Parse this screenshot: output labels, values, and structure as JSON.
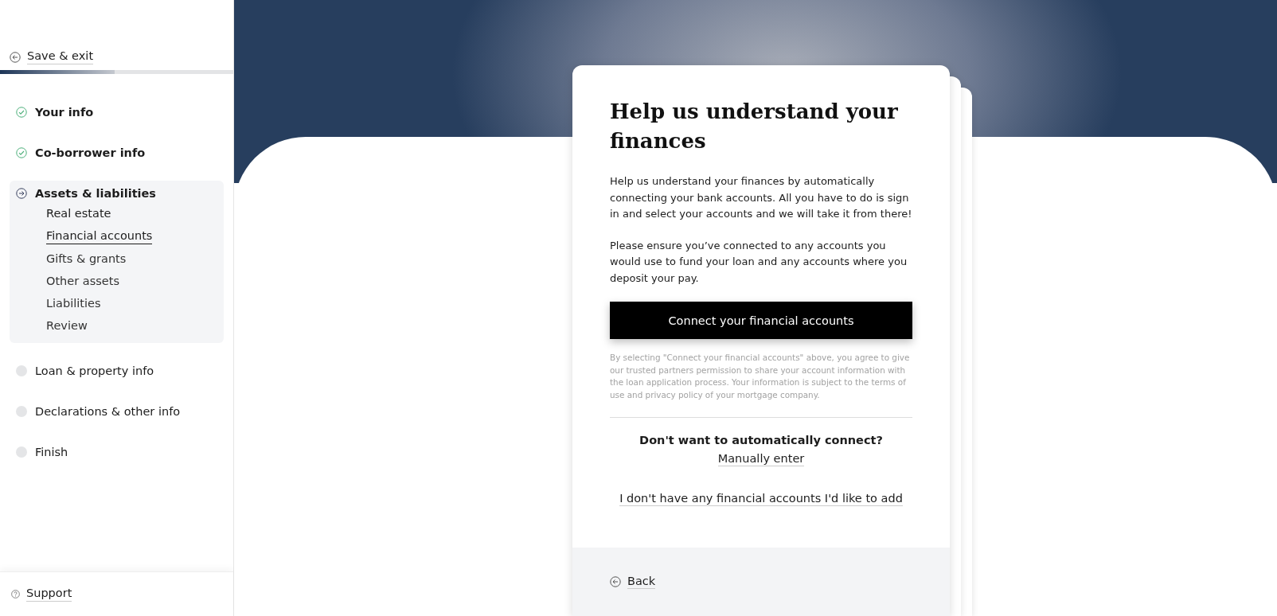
{
  "sidebar": {
    "save_exit": "Save & exit",
    "progress": {
      "level": 0.49
    },
    "steps": [
      {
        "label": "Your info",
        "kind": "done",
        "expanded": false
      },
      {
        "label": "Co-borrower info",
        "kind": "done",
        "expanded": false
      },
      {
        "label": "Assets & liabilities",
        "kind": "current",
        "expanded": true,
        "children": [
          {
            "label": "Real estate",
            "selected": false,
            "kind": "done"
          },
          {
            "label": "Financial accounts",
            "selected": true,
            "kind": "current"
          },
          {
            "label": "Gifts & grants",
            "selected": false,
            "kind": "todo"
          },
          {
            "label": "Other assets",
            "selected": false,
            "kind": "todo"
          },
          {
            "label": "Liabilities",
            "selected": false,
            "kind": "todo"
          },
          {
            "label": "Review",
            "selected": false,
            "kind": "todo"
          }
        ]
      },
      {
        "label": "Loan & property info",
        "kind": "todo",
        "expanded": false
      },
      {
        "label": "Declarations & other info",
        "kind": "todo",
        "expanded": false
      },
      {
        "label": "Finish",
        "kind": "todo",
        "expanded": false
      }
    ],
    "support": "Support"
  },
  "card": {
    "title": "Help us understand your finances",
    "paragraphs": [
      "Help us understand your finances by automatically connecting your bank accounts. All you have to do is sign in and select your accounts and we will take it from there!",
      "Please ensure you’ve connected to any accounts you would use to fund your loan and any accounts where you deposit your pay."
    ],
    "connect_button": "Connect your financial accounts",
    "disclaimer": "By selecting \"Connect your financial accounts\" above, you agree to give our trusted partners permission to share your account information with the loan application process. Your information is subject to the terms of use and privacy policy of your mortgage company.",
    "manual_question": "Don't want to automatically connect?",
    "manual_link": "Manually enter",
    "no_accounts_link": "I don't have any financial accounts I'd like to add",
    "back": "Back"
  }
}
